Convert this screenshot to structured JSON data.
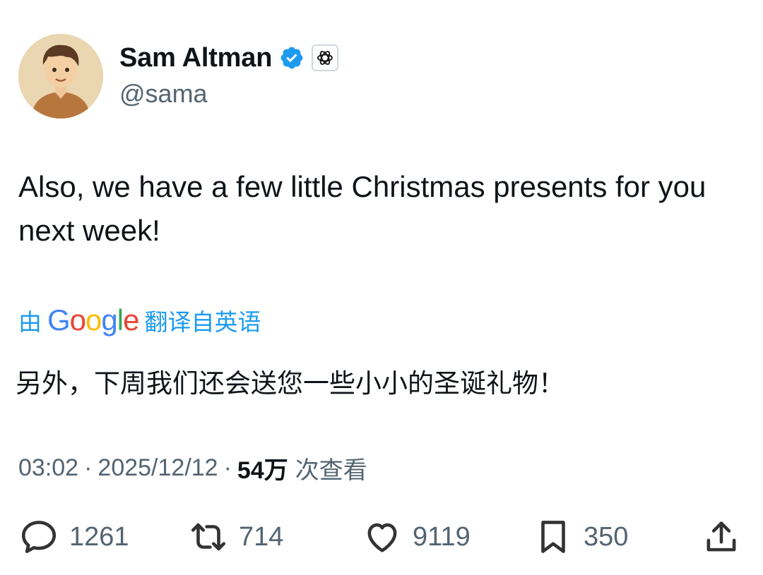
{
  "author": {
    "name": "Sam Altman",
    "handle": "@sama",
    "verified_icon": "verified-badge-icon",
    "affiliation_icon": "openai-logo-icon"
  },
  "tweet": {
    "text": "Also, we have a few little Christmas presents for you next week!"
  },
  "translation": {
    "prefix": "由",
    "provider": "Google",
    "suffix": "翻译自英语",
    "text": "另外，下周我们还会送您一些小小的圣诞礼物！"
  },
  "meta": {
    "time": "03:02",
    "date": "2025/12/12",
    "views_count": "54万",
    "views_label": "次查看",
    "separator": "·"
  },
  "actions": {
    "replies": "1261",
    "reposts": "714",
    "likes": "9119",
    "bookmarks": "350"
  },
  "colors": {
    "link": "#1d9bf0",
    "muted": "#536471",
    "text": "#0f1419"
  }
}
